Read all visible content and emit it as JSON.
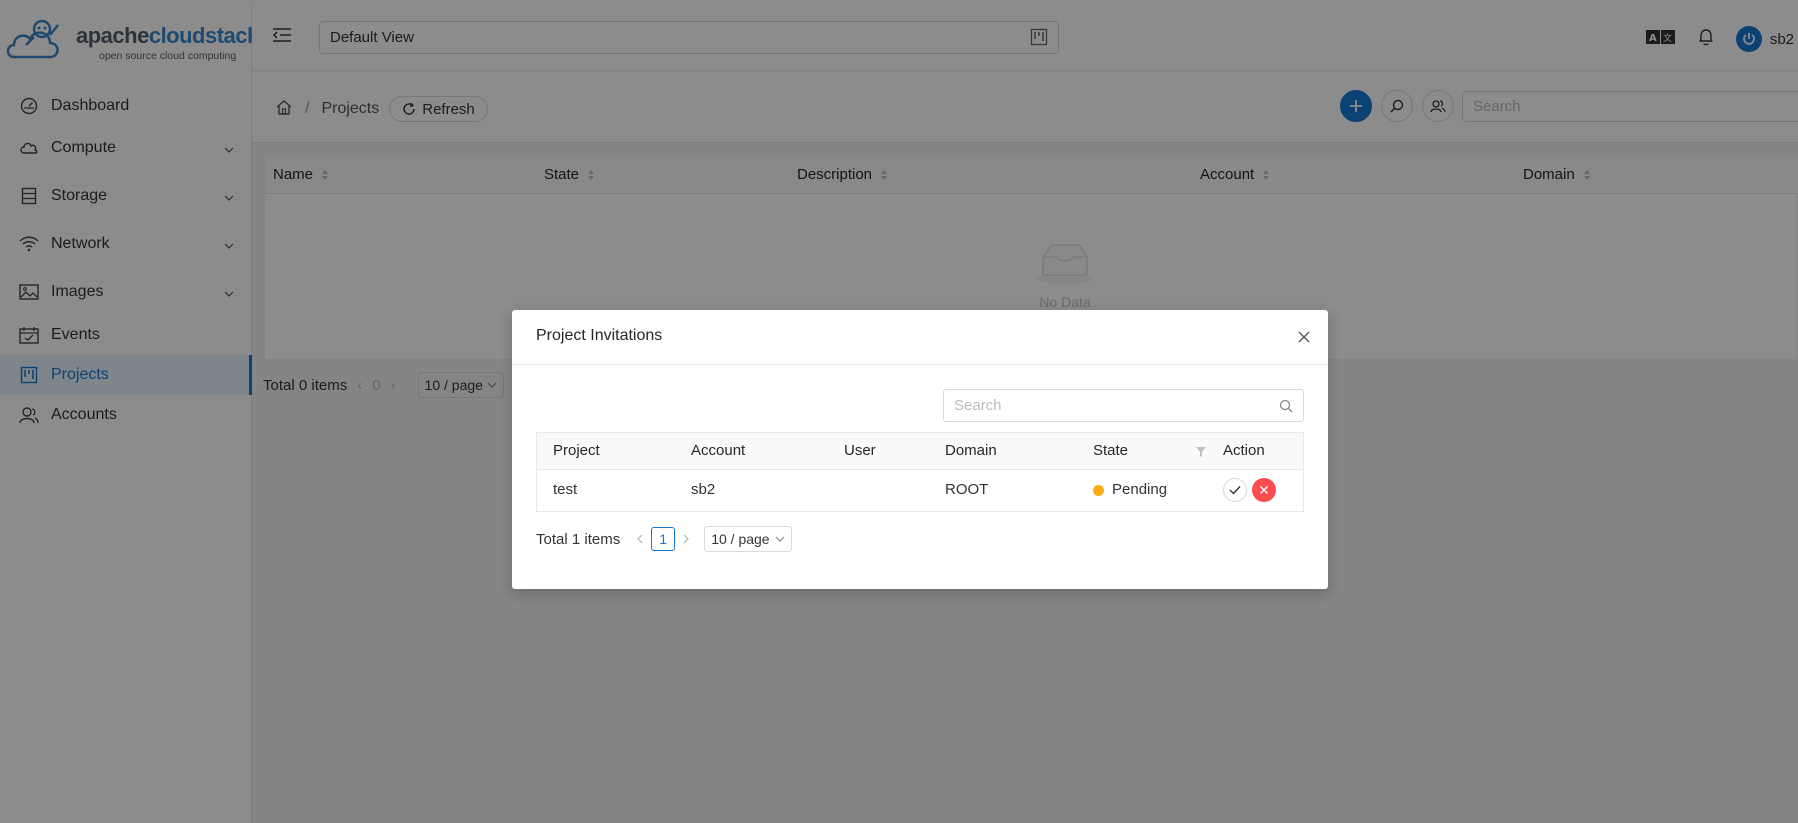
{
  "brand": {
    "name_a": "apache",
    "name_b": "cloudstack",
    "tm": "™",
    "tagline": "open source cloud computing"
  },
  "sidebar": {
    "items": [
      {
        "label": "Dashboard",
        "icon": "dashboard-icon",
        "expandable": false
      },
      {
        "label": "Compute",
        "icon": "cloud-icon",
        "expandable": true
      },
      {
        "label": "Storage",
        "icon": "database-icon",
        "expandable": true
      },
      {
        "label": "Network",
        "icon": "wifi-icon",
        "expandable": true
      },
      {
        "label": "Images",
        "icon": "picture-icon",
        "expandable": true
      },
      {
        "label": "Events",
        "icon": "calendar-icon",
        "expandable": false
      },
      {
        "label": "Projects",
        "icon": "project-icon",
        "expandable": false,
        "active": true
      },
      {
        "label": "Accounts",
        "icon": "team-icon",
        "expandable": false
      }
    ]
  },
  "header": {
    "view": "Default View",
    "user": "sb2"
  },
  "breadcrumb": {
    "current": "Projects",
    "refresh": "Refresh"
  },
  "search": {
    "placeholder": "Search"
  },
  "table": {
    "columns": [
      "Name",
      "State",
      "Description",
      "Account",
      "Domain"
    ],
    "empty_text": "No Data",
    "total": "Total 0 items",
    "page": "0",
    "page_size": "10 / page"
  },
  "modal": {
    "title": "Project Invitations",
    "search_placeholder": "Search",
    "columns": [
      "Project",
      "Account",
      "User",
      "Domain",
      "State",
      "Action"
    ],
    "rows": [
      {
        "project": "test",
        "account": "sb2",
        "user": "",
        "domain": "ROOT",
        "state": "Pending"
      }
    ],
    "total": "Total 1 items",
    "page": "1",
    "page_size": "10 / page"
  },
  "colors": {
    "primary": "#1677d2",
    "pending": "#faad14",
    "danger": "#ff4d4f"
  }
}
